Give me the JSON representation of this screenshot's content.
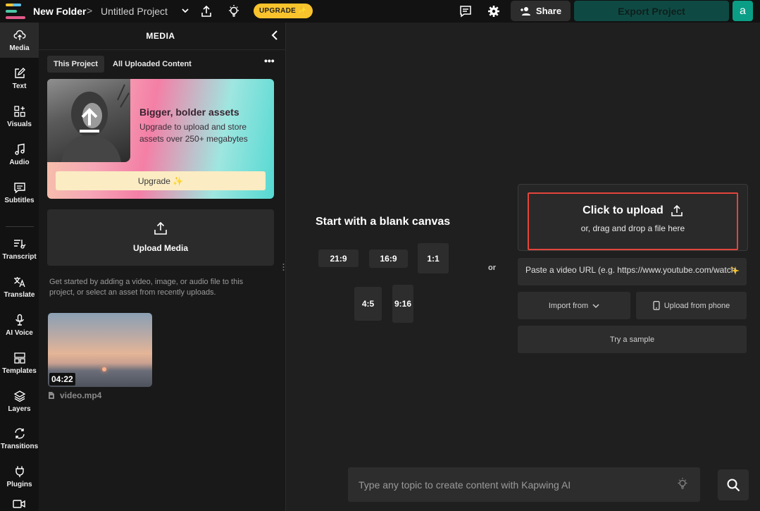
{
  "header": {
    "folder": "New Folder",
    "separator": ">",
    "project": "Untitled Project",
    "upgrade_label": "UPGRADE ✨",
    "share_label": "Share",
    "export_label": "Export Project",
    "avatar_letter": "a"
  },
  "nav": {
    "items": [
      {
        "label": "Media",
        "icon": "upload-cloud-icon"
      },
      {
        "label": "Text",
        "icon": "pencil-square-icon"
      },
      {
        "label": "Visuals",
        "icon": "shapes-icon"
      },
      {
        "label": "Audio",
        "icon": "music-note-icon"
      },
      {
        "label": "Subtitles",
        "icon": "captions-icon"
      },
      {
        "label": "Transcript",
        "icon": "transcript-icon"
      },
      {
        "label": "Translate",
        "icon": "translate-icon"
      },
      {
        "label": "AI Voice",
        "icon": "microphone-icon"
      },
      {
        "label": "Templates",
        "icon": "grid-icon"
      },
      {
        "label": "Layers",
        "icon": "layers-icon"
      },
      {
        "label": "Transitions",
        "icon": "transitions-icon"
      },
      {
        "label": "Plugins",
        "icon": "plug-icon"
      }
    ]
  },
  "media_panel": {
    "title": "MEDIA",
    "tabs": [
      "This Project",
      "All Uploaded Content"
    ],
    "more": "•••",
    "promo": {
      "title": "Bigger, bolder assets",
      "text": "Upgrade to upload and store assets over 250+ megabytes",
      "button": "Upgrade ✨"
    },
    "upload_label": "Upload Media",
    "hint": "Get started by adding a video, image, or audio file to this project, or select an asset from recently uploads.",
    "asset": {
      "duration": "04:22",
      "filename": "video.mp4"
    }
  },
  "canvas": {
    "blank_title": "Start with a blank canvas",
    "ratios": [
      "21:9",
      "16:9",
      "1:1",
      "4:5",
      "9:16"
    ],
    "or": "or",
    "upload_title": "Click to upload",
    "upload_sub": "or, drag and drop a file here",
    "url_placeholder": "Paste a video URL (e.g. https://www.youtube.com/watch",
    "import_label": "Import from",
    "phone_label": "Upload from phone",
    "sample_label": "Try a sample",
    "ai_placeholder": "Type any topic to create content with Kapwing AI"
  },
  "colors": {
    "accent_red": "#e2453c",
    "upgrade_yellow": "#f8c32c",
    "export_green": "#0e4a43",
    "avatar_teal": "#0a9e86"
  }
}
